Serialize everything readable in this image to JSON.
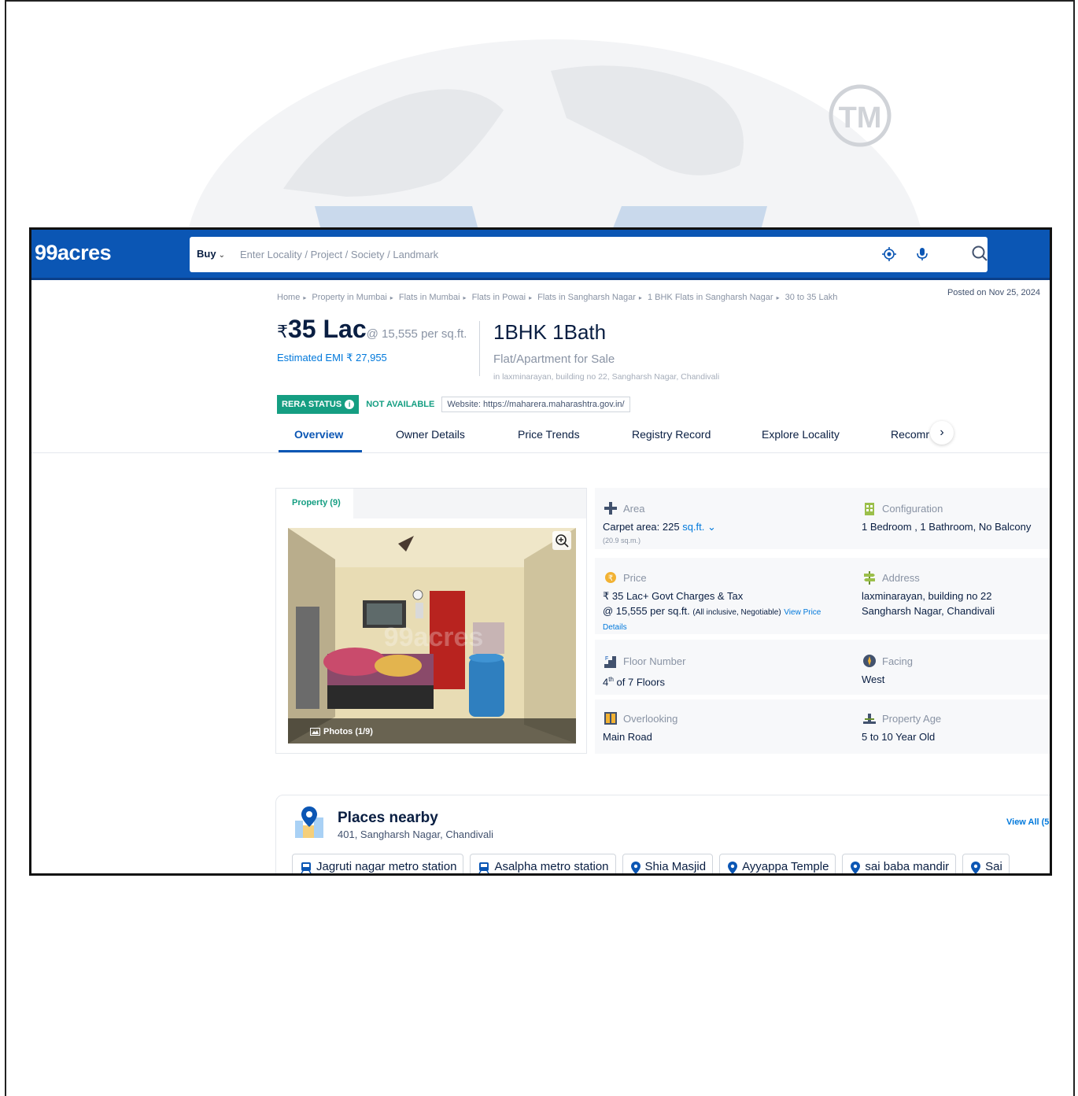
{
  "header": {
    "logo": "99acres",
    "buy_label": "Buy",
    "search_placeholder": "Enter Locality / Project / Society / Landmark"
  },
  "breadcrumb": [
    "Home",
    "Property in Mumbai",
    "Flats in Mumbai",
    "Flats in Powai",
    "Flats in Sangharsh Nagar",
    "1 BHK Flats in Sangharsh Nagar",
    "30 to 35 Lakh"
  ],
  "posted": "Posted on Nov 25, 2024",
  "price": {
    "currency": "₹",
    "amount": "35 Lac",
    "rate": "@ 15,555 per sq.ft.",
    "emi": "Estimated EMI ₹ 27,955"
  },
  "title": {
    "bhk": "1BHK 1Bath",
    "type": "Flat/Apartment for Sale",
    "location": "in laxminarayan, building no 22, Sangharsh Nagar, Chandivali"
  },
  "rera": {
    "status": "RERA STATUS",
    "value": "NOT AVAILABLE",
    "website": "Website: https://maharera.maharashtra.gov.in/"
  },
  "tabs": [
    "Overview",
    "Owner Details",
    "Price Trends",
    "Registry Record",
    "Explore Locality",
    "Recomr"
  ],
  "gallery": {
    "tab": "Property (9)",
    "photo_count": "Photos (1/9)",
    "watermark": "99acres"
  },
  "details": {
    "area": {
      "label": "Area",
      "value": "Carpet area: 225",
      "unit": "sq.ft.",
      "sub": "(20.9 sq.m.)"
    },
    "configuration": {
      "label": "Configuration",
      "value": "1 Bedroom , 1 Bathroom, No Balcony"
    },
    "price": {
      "label": "Price",
      "line1": "₹ 35 Lac+ Govt Charges & Tax",
      "line2": "@ 15,555 per sq.ft.",
      "note": "(All inclusive, Negotiable)",
      "link": "View Price",
      "link2": "Details"
    },
    "address": {
      "label": "Address",
      "line1": "laxminarayan, building no 22",
      "line2": "Sangharsh Nagar, Chandivali"
    },
    "floor": {
      "label": "Floor Number",
      "floor": "4",
      "sup": "th",
      "rest": "of 7 Floors"
    },
    "facing": {
      "label": "Facing",
      "value": "West"
    },
    "overlooking": {
      "label": "Overlooking",
      "value": "Main Road"
    },
    "age": {
      "label": "Property Age",
      "value": "5 to 10 Year Old"
    }
  },
  "places": {
    "title": "Places nearby",
    "subtitle": "401, Sangharsh Nagar, Chandivali",
    "view_all": "View All (5",
    "chips": [
      {
        "icon": "metro-icon",
        "label": "Jagruti nagar metro station"
      },
      {
        "icon": "metro-icon",
        "label": "Asalpha metro station"
      },
      {
        "icon": "location-pin-icon",
        "label": "Shia Masjid"
      },
      {
        "icon": "location-pin-icon",
        "label": "Ayyappa Temple"
      },
      {
        "icon": "location-pin-icon",
        "label": "sai baba mandir"
      },
      {
        "icon": "location-pin-icon",
        "label": "Sai"
      }
    ]
  },
  "colors": {
    "brand_blue": "#0b56b4",
    "rera_green": "#159e82",
    "link_blue": "#0078db"
  }
}
